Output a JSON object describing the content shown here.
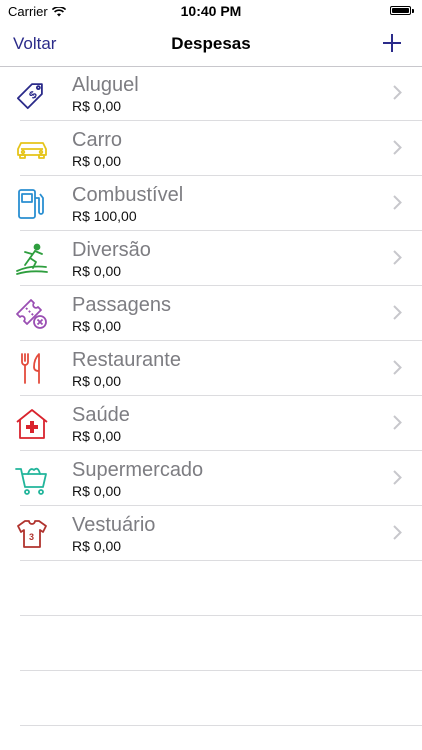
{
  "status_bar": {
    "carrier": "Carrier",
    "time": "10:40 PM"
  },
  "nav": {
    "back_label": "Voltar",
    "title": "Despesas",
    "add_icon": "plus-icon"
  },
  "colors": {
    "accent": "#2b2b8a",
    "title_text": "#7d7d82",
    "separator": "#dcdcdf"
  },
  "categories": [
    {
      "label": "Aluguel",
      "value": "R$ 0,00",
      "icon": "price-tag-icon",
      "color": "#2b2b8a"
    },
    {
      "label": "Carro",
      "value": "R$ 0,00",
      "icon": "car-icon",
      "color": "#e5c41a"
    },
    {
      "label": "Combustível",
      "value": "R$ 100,00",
      "icon": "fuel-pump-icon",
      "color": "#2a8fd1"
    },
    {
      "label": "Diversão",
      "value": "R$ 0,00",
      "icon": "surfer-icon",
      "color": "#2e9e3e"
    },
    {
      "label": "Passagens",
      "value": "R$ 0,00",
      "icon": "ticket-icon",
      "color": "#9a4fb3"
    },
    {
      "label": "Restaurante",
      "value": "R$ 0,00",
      "icon": "fork-knife-icon",
      "color": "#e34b3c"
    },
    {
      "label": "Saúde",
      "value": "R$ 0,00",
      "icon": "hospital-icon",
      "color": "#d9232d"
    },
    {
      "label": "Supermercado",
      "value": "R$ 0,00",
      "icon": "shopping-cart-icon",
      "color": "#22b59b"
    },
    {
      "label": "Vestuário",
      "value": "R$ 0,00",
      "icon": "shirt-icon",
      "color": "#b0332e"
    }
  ]
}
